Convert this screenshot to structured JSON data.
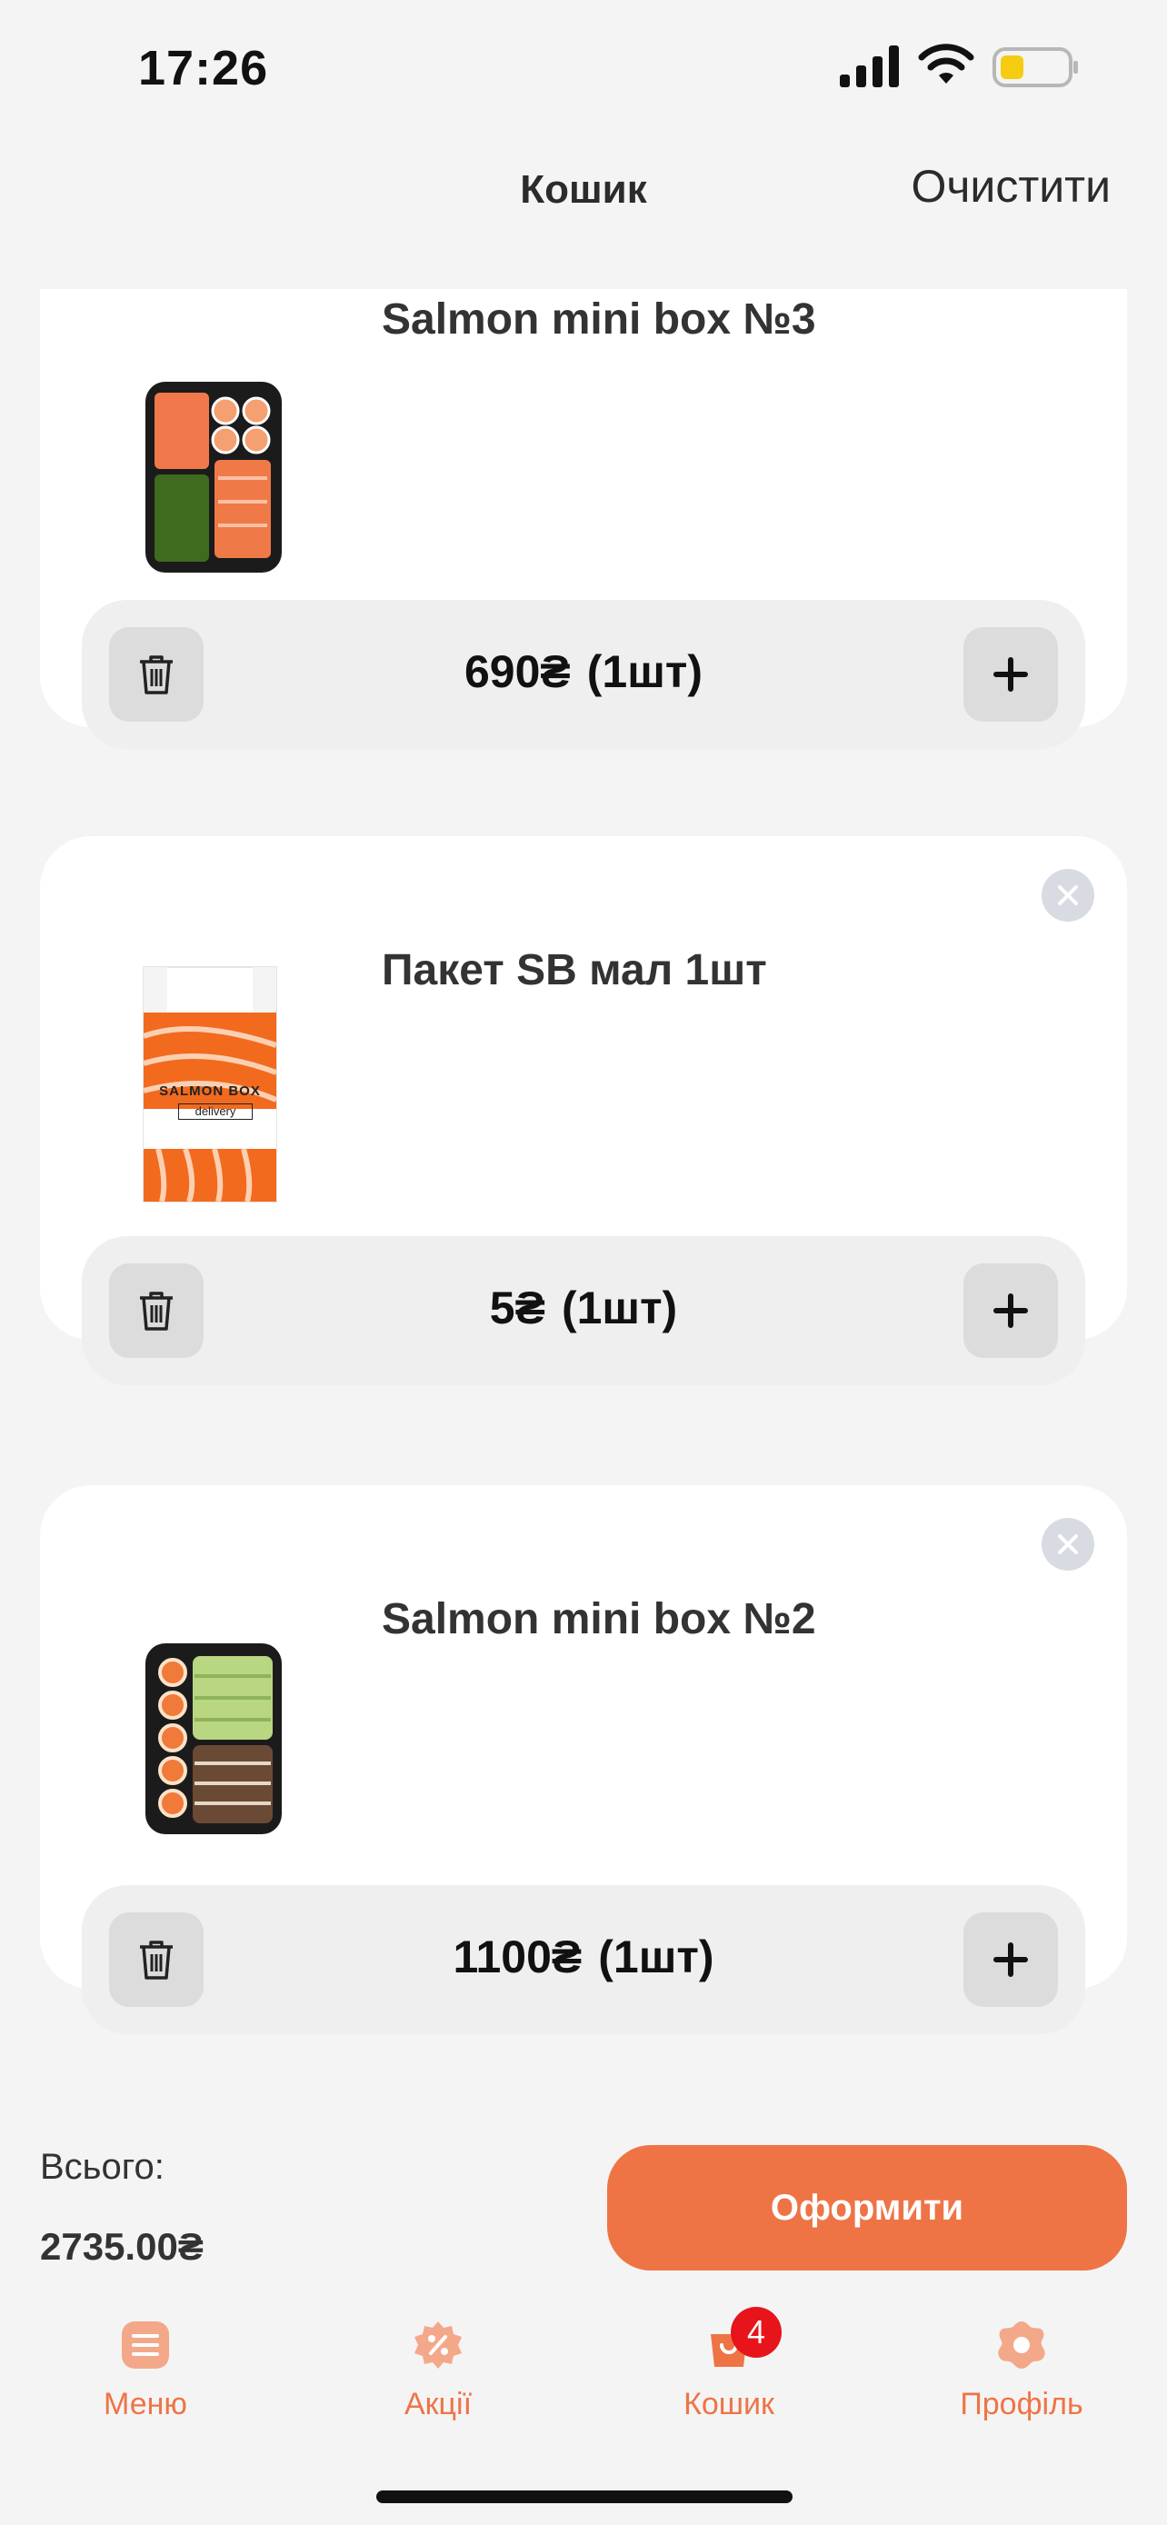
{
  "status_bar": {
    "time": "17:26"
  },
  "header": {
    "title": "Кошик",
    "clear_label": "Очистити"
  },
  "cart": {
    "items": [
      {
        "name": "Salmon mini box №3",
        "price": "690₴",
        "quantity": "(1шт)",
        "image": "sushi-box-3-image"
      },
      {
        "name": "Пакет SB мал 1шт",
        "price": "5₴",
        "quantity": "(1шт)",
        "image": "salmon-box-bag-image",
        "bag_brand": "SALMON BOX",
        "bag_subtitle": "delivery"
      },
      {
        "name": "Salmon mini box №2",
        "price": "1100₴",
        "quantity": "(1шт)",
        "image": "sushi-box-2-image"
      }
    ]
  },
  "footer": {
    "total_label": "Всього:",
    "total_value": "2735.00₴",
    "checkout_label": "Оформити"
  },
  "tabs": [
    {
      "label": "Меню",
      "icon": "menu-icon"
    },
    {
      "label": "Акції",
      "icon": "promo-icon"
    },
    {
      "label": "Кошик",
      "icon": "cart-icon",
      "badge": "4"
    },
    {
      "label": "Профіль",
      "icon": "profile-icon"
    }
  ],
  "colors": {
    "accent": "#ee7446",
    "badge": "#e8141b",
    "background": "#f4f4f4"
  }
}
